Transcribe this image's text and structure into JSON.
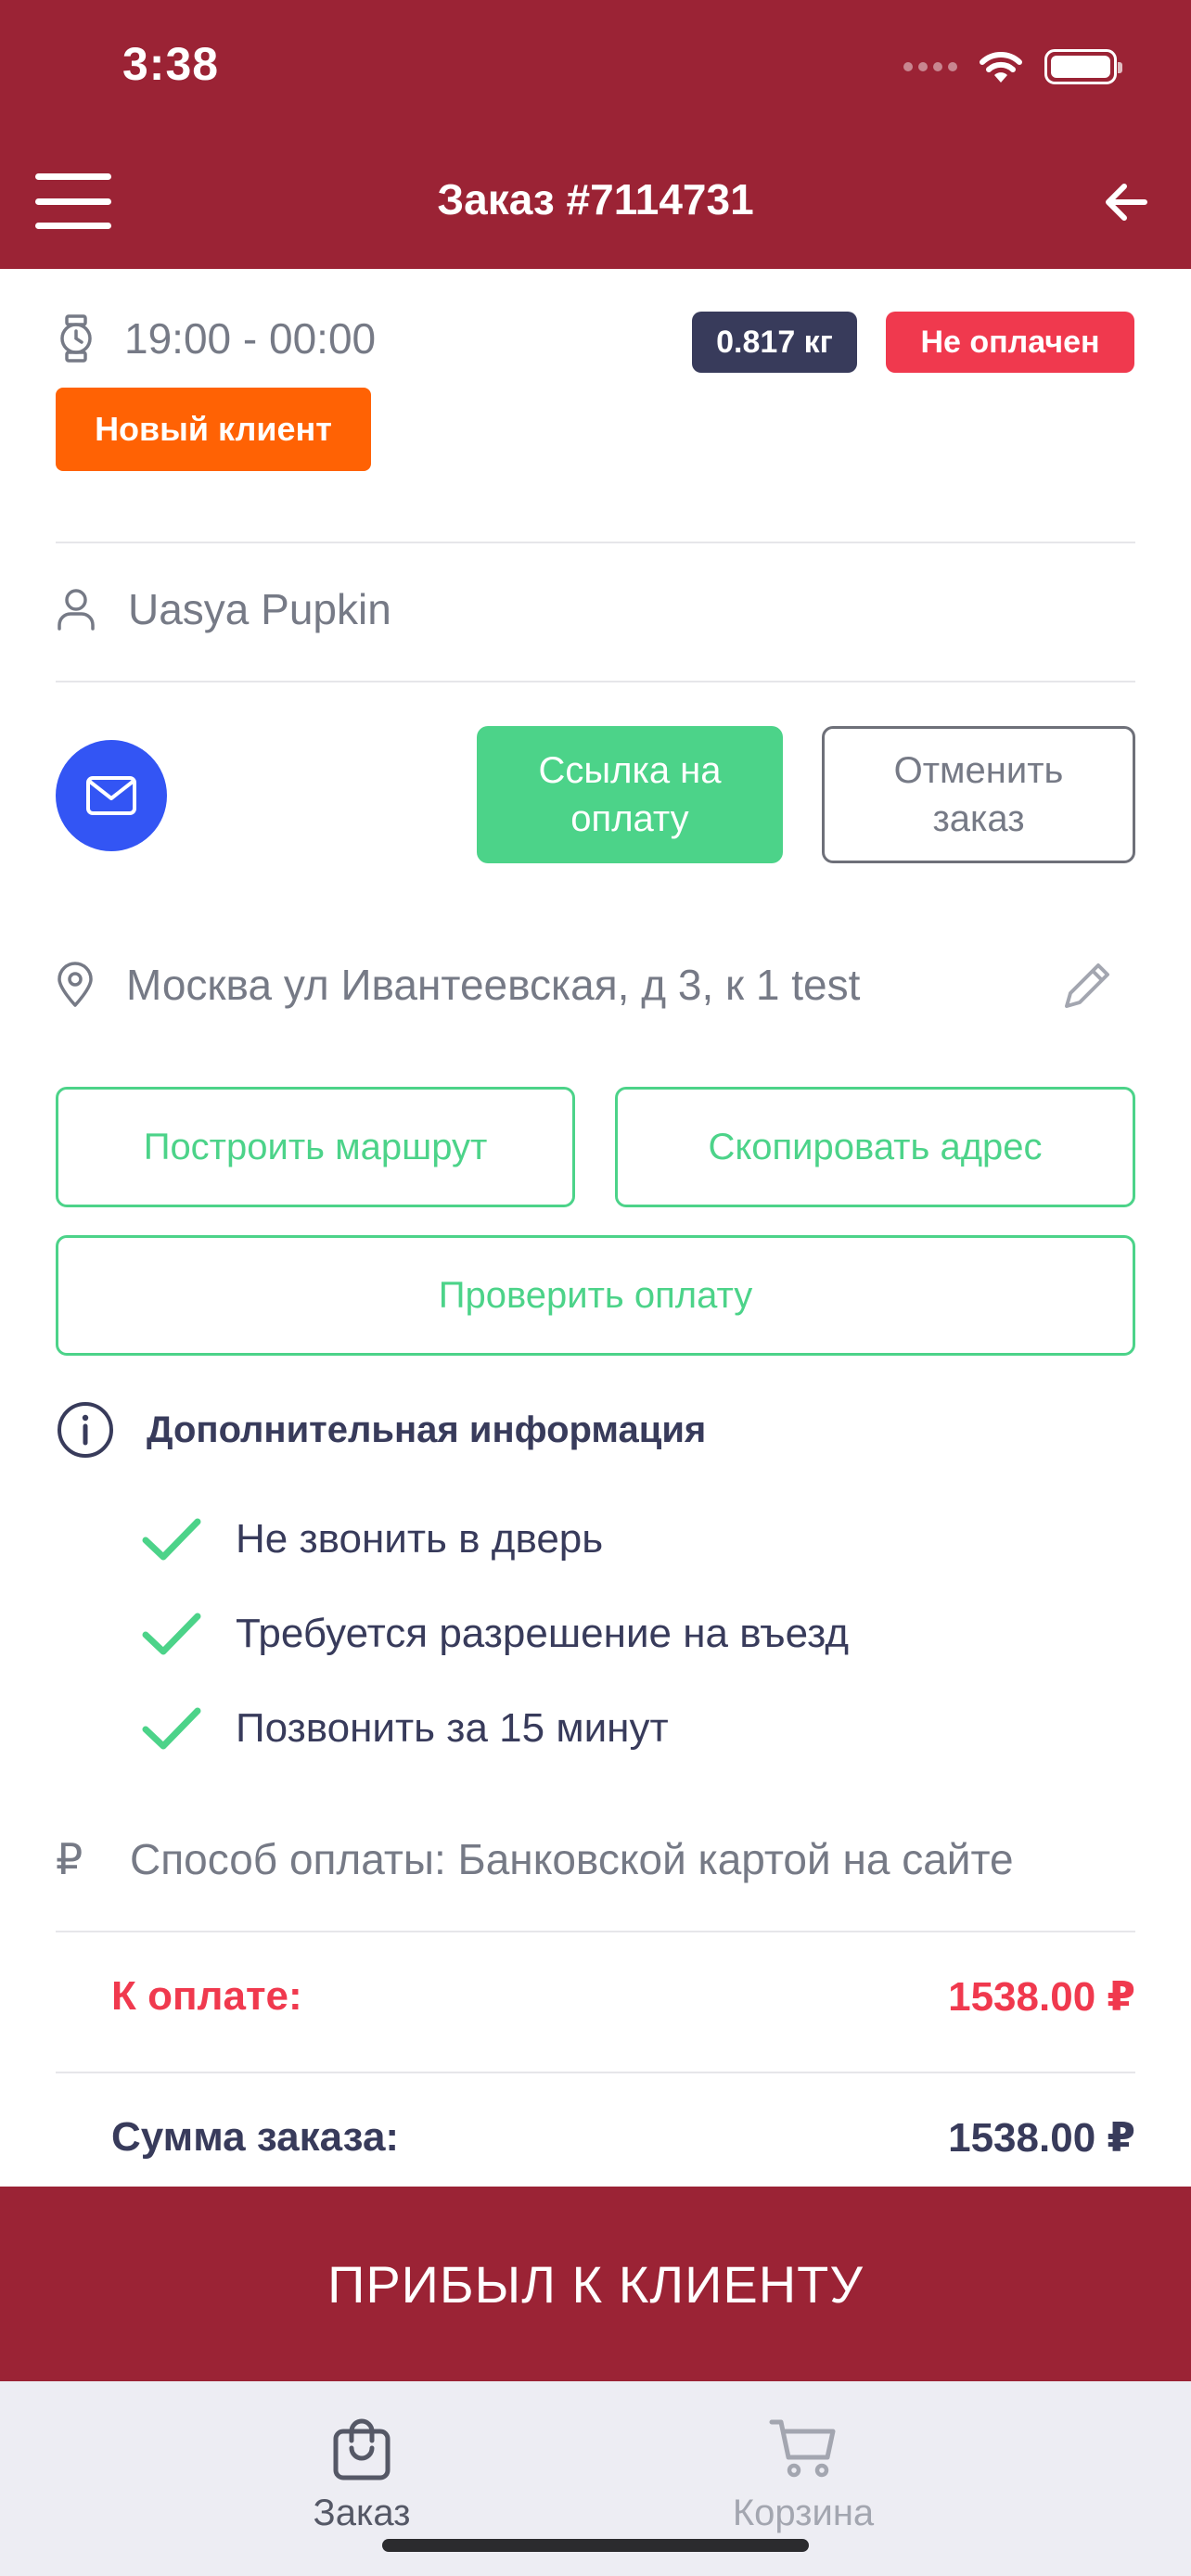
{
  "status_bar": {
    "time": "3:38"
  },
  "nav": {
    "title": "Заказ #7114731"
  },
  "order": {
    "time_window": "19:00 - 00:00",
    "weight_badge": "0.817 кг",
    "payment_badge": "Не оплачен",
    "client_badge": "Новый клиент",
    "customer_name": "Uasya Pupkin",
    "pay_link_label": "Ссылка на оплату",
    "cancel_label": "Отменить заказ",
    "address": "Москва ул Ивантеевская, д 3, к 1 test",
    "route_label": "Построить маршрут",
    "copy_address_label": "Скопировать адрес",
    "check_payment_label": "Проверить оплату",
    "extra_info_title": "Дополнительная информация",
    "extra_info_items": [
      "Не звонить в дверь",
      "Требуется разрешение на въезд",
      "Позвонить за 15 минут"
    ],
    "payment_method": "Способ оплаты: Банковской картой на сайте",
    "ruble_symbol": "₽",
    "due_label": "К оплате:",
    "due_value": "1538.00 ₽",
    "total_label": "Сумма заказа:",
    "total_value": "1538.00 ₽"
  },
  "arrived_button": "ПРИБЫЛ К КЛИЕНТУ",
  "tabs": [
    {
      "label": "Заказ",
      "icon": "shopping-bag-icon",
      "active": true
    },
    {
      "label": "Корзина",
      "icon": "cart-icon",
      "active": false
    }
  ],
  "colors": {
    "brand": "#9b2335",
    "green": "#4cd389",
    "red": "#f0394e",
    "orange": "#ff6204",
    "blue": "#3355f4",
    "navy": "#383b5b"
  }
}
